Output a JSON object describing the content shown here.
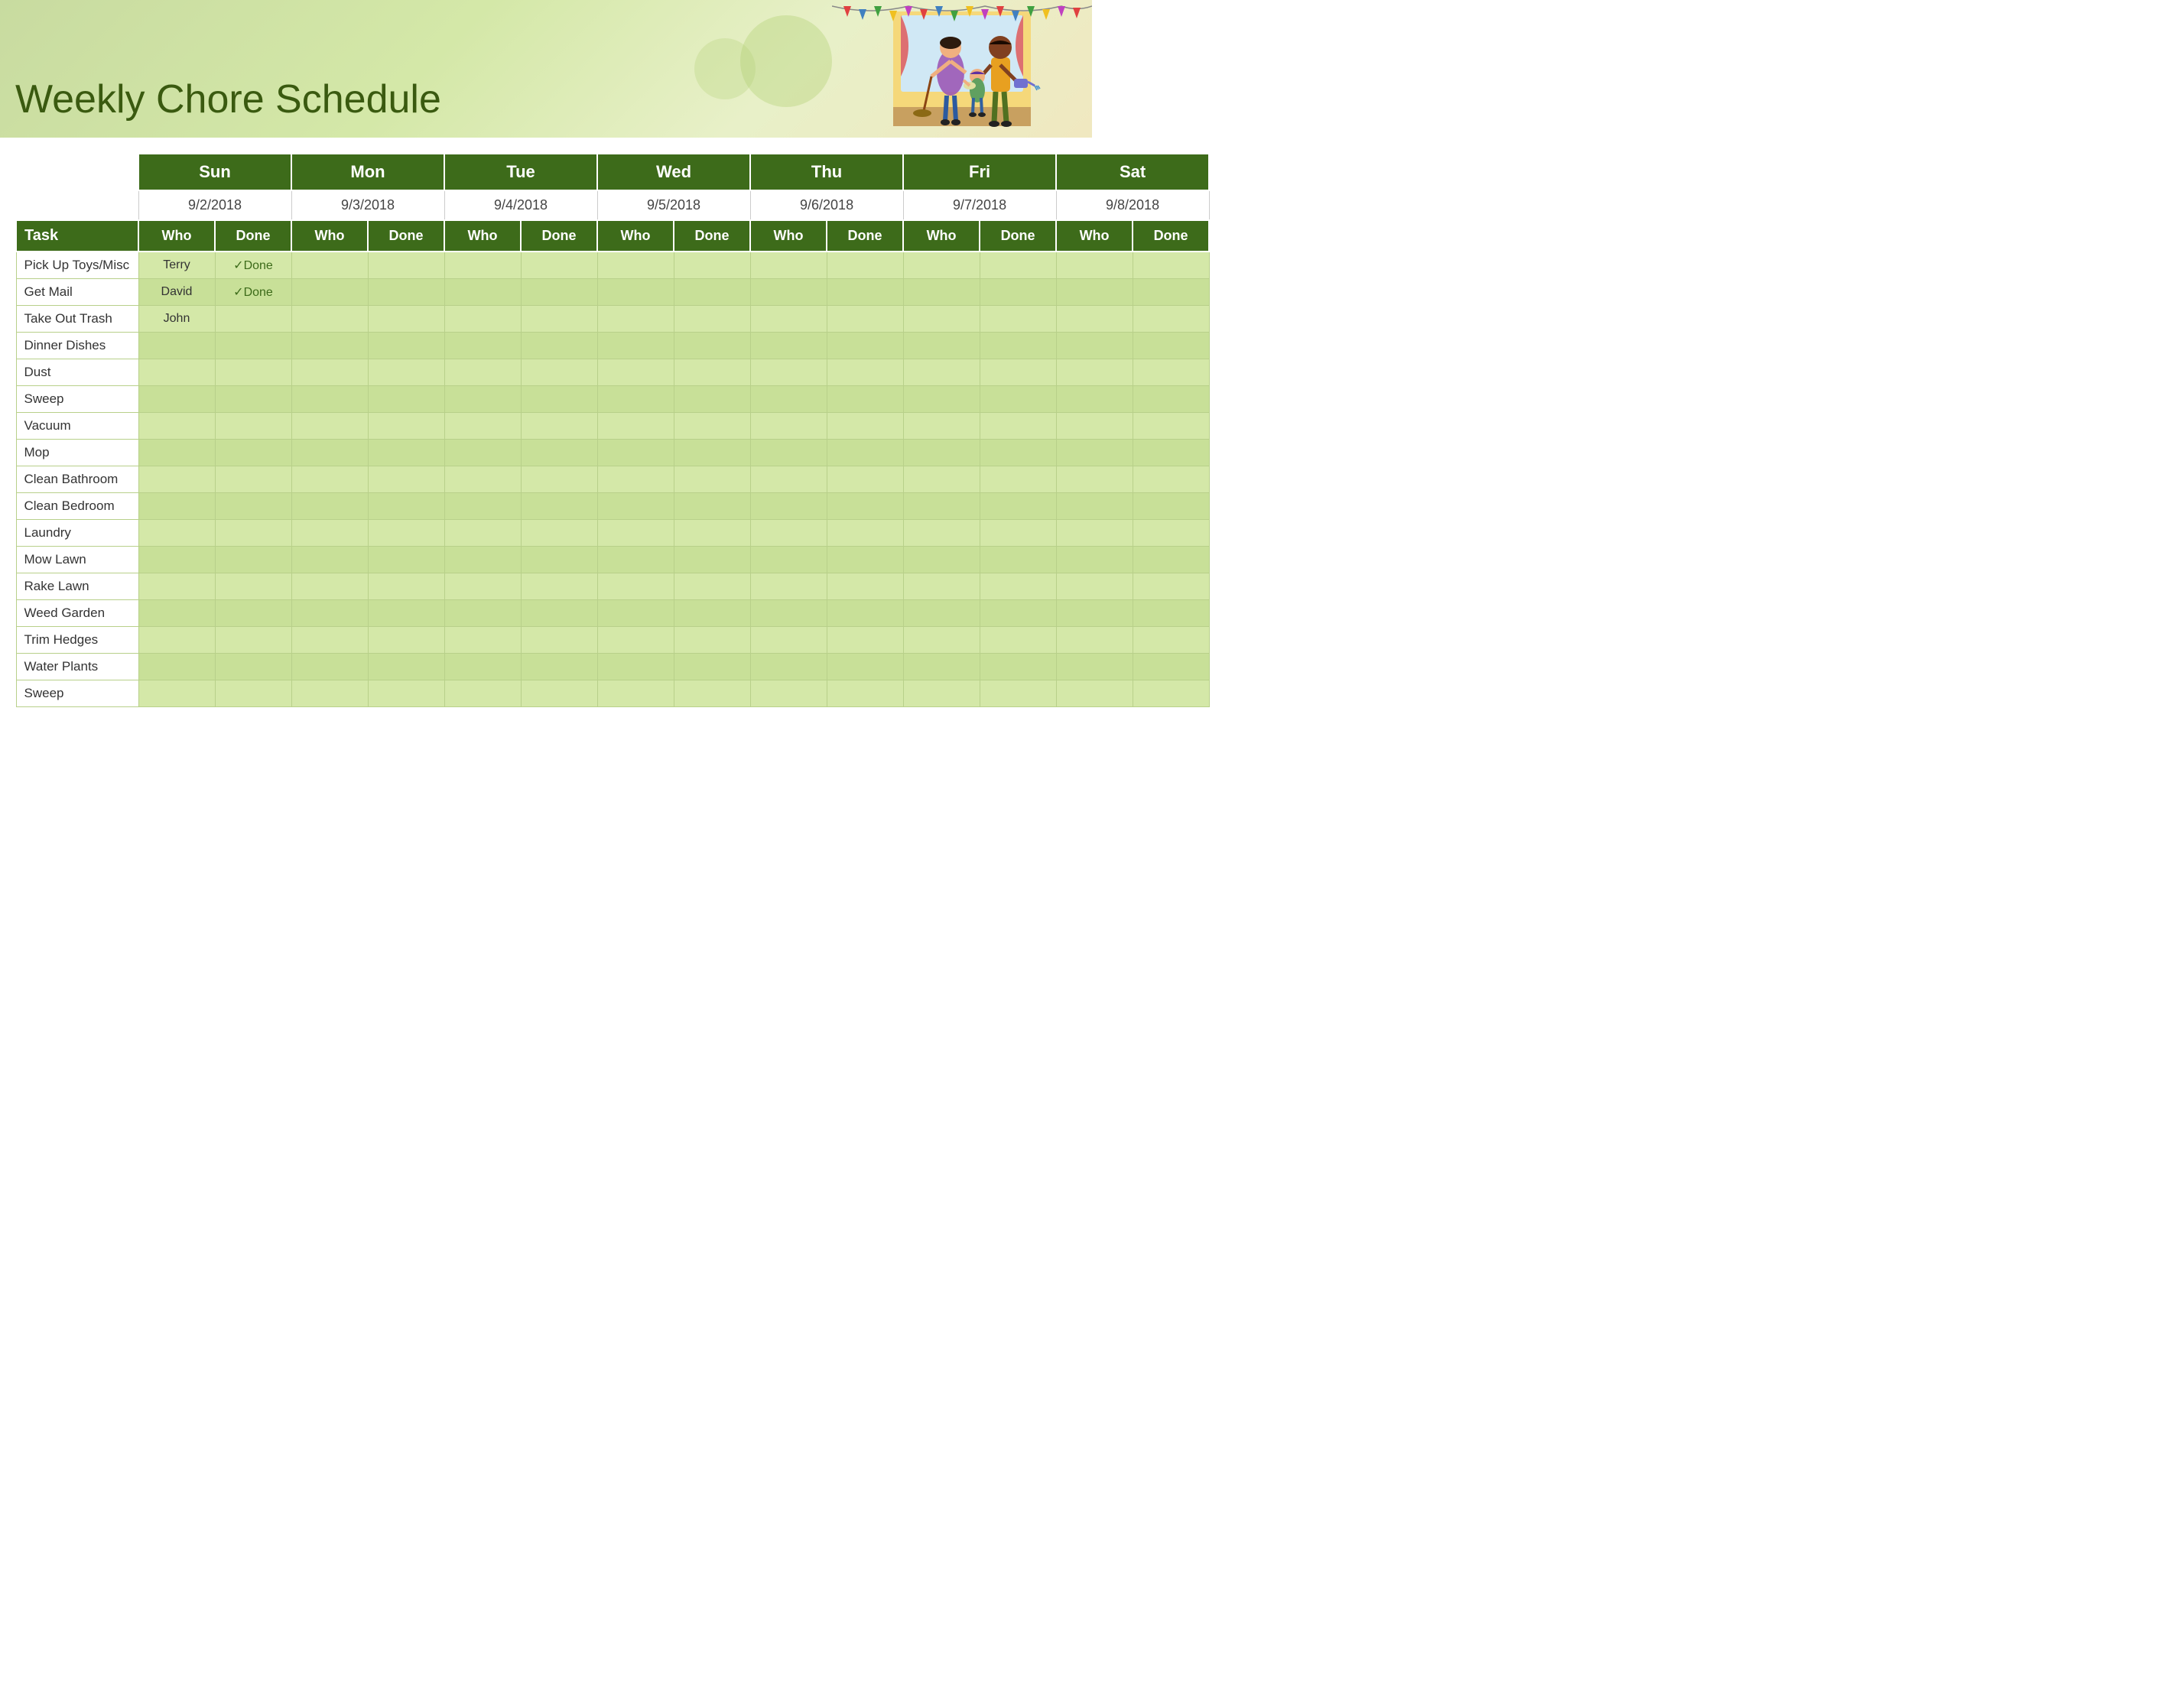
{
  "header": {
    "title": "Weekly Chore Schedule"
  },
  "table": {
    "days": [
      {
        "name": "Sun",
        "date": "9/2/2018"
      },
      {
        "name": "Mon",
        "date": "9/3/2018"
      },
      {
        "name": "Tue",
        "date": "9/4/2018"
      },
      {
        "name": "Wed",
        "date": "9/5/2018"
      },
      {
        "name": "Thu",
        "date": "9/6/2018"
      },
      {
        "name": "Fri",
        "date": "9/7/2018"
      },
      {
        "name": "Sat",
        "date": "9/8/2018"
      }
    ],
    "subheader": {
      "task": "Task",
      "who": "Who",
      "done": "Done"
    },
    "rows": [
      {
        "task": "Pick Up Toys/Misc",
        "sun_who": "Terry",
        "sun_done": "✓Done",
        "mon_who": "",
        "mon_done": "",
        "tue_who": "",
        "tue_done": "",
        "wed_who": "",
        "wed_done": "",
        "thu_who": "",
        "thu_done": "",
        "fri_who": "",
        "fri_done": "",
        "sat_who": "",
        "sat_done": ""
      },
      {
        "task": "Get Mail",
        "sun_who": "David",
        "sun_done": "✓Done",
        "mon_who": "",
        "mon_done": "",
        "tue_who": "",
        "tue_done": "",
        "wed_who": "",
        "wed_done": "",
        "thu_who": "",
        "thu_done": "",
        "fri_who": "",
        "fri_done": "",
        "sat_who": "",
        "sat_done": ""
      },
      {
        "task": "Take Out Trash",
        "sun_who": "John",
        "sun_done": "",
        "mon_who": "",
        "mon_done": "",
        "tue_who": "",
        "tue_done": "",
        "wed_who": "",
        "wed_done": "",
        "thu_who": "",
        "thu_done": "",
        "fri_who": "",
        "fri_done": "",
        "sat_who": "",
        "sat_done": ""
      },
      {
        "task": "Dinner Dishes",
        "sun_who": "",
        "sun_done": "",
        "mon_who": "",
        "mon_done": "",
        "tue_who": "",
        "tue_done": "",
        "wed_who": "",
        "wed_done": "",
        "thu_who": "",
        "thu_done": "",
        "fri_who": "",
        "fri_done": "",
        "sat_who": "",
        "sat_done": ""
      },
      {
        "task": "Dust",
        "sun_who": "",
        "sun_done": "",
        "mon_who": "",
        "mon_done": "",
        "tue_who": "",
        "tue_done": "",
        "wed_who": "",
        "wed_done": "",
        "thu_who": "",
        "thu_done": "",
        "fri_who": "",
        "fri_done": "",
        "sat_who": "",
        "sat_done": ""
      },
      {
        "task": "Sweep",
        "sun_who": "",
        "sun_done": "",
        "mon_who": "",
        "mon_done": "",
        "tue_who": "",
        "tue_done": "",
        "wed_who": "",
        "wed_done": "",
        "thu_who": "",
        "thu_done": "",
        "fri_who": "",
        "fri_done": "",
        "sat_who": "",
        "sat_done": ""
      },
      {
        "task": "Vacuum",
        "sun_who": "",
        "sun_done": "",
        "mon_who": "",
        "mon_done": "",
        "tue_who": "",
        "tue_done": "",
        "wed_who": "",
        "wed_done": "",
        "thu_who": "",
        "thu_done": "",
        "fri_who": "",
        "fri_done": "",
        "sat_who": "",
        "sat_done": ""
      },
      {
        "task": "Mop",
        "sun_who": "",
        "sun_done": "",
        "mon_who": "",
        "mon_done": "",
        "tue_who": "",
        "tue_done": "",
        "wed_who": "",
        "wed_done": "",
        "thu_who": "",
        "thu_done": "",
        "fri_who": "",
        "fri_done": "",
        "sat_who": "",
        "sat_done": ""
      },
      {
        "task": "Clean Bathroom",
        "sun_who": "",
        "sun_done": "",
        "mon_who": "",
        "mon_done": "",
        "tue_who": "",
        "tue_done": "",
        "wed_who": "",
        "wed_done": "",
        "thu_who": "",
        "thu_done": "",
        "fri_who": "",
        "fri_done": "",
        "sat_who": "",
        "sat_done": ""
      },
      {
        "task": "Clean Bedroom",
        "sun_who": "",
        "sun_done": "",
        "mon_who": "",
        "mon_done": "",
        "tue_who": "",
        "tue_done": "",
        "wed_who": "",
        "wed_done": "",
        "thu_who": "",
        "thu_done": "",
        "fri_who": "",
        "fri_done": "",
        "sat_who": "",
        "sat_done": ""
      },
      {
        "task": "Laundry",
        "sun_who": "",
        "sun_done": "",
        "mon_who": "",
        "mon_done": "",
        "tue_who": "",
        "tue_done": "",
        "wed_who": "",
        "wed_done": "",
        "thu_who": "",
        "thu_done": "",
        "fri_who": "",
        "fri_done": "",
        "sat_who": "",
        "sat_done": ""
      },
      {
        "task": "Mow Lawn",
        "sun_who": "",
        "sun_done": "",
        "mon_who": "",
        "mon_done": "",
        "tue_who": "",
        "tue_done": "",
        "wed_who": "",
        "wed_done": "",
        "thu_who": "",
        "thu_done": "",
        "fri_who": "",
        "fri_done": "",
        "sat_who": "",
        "sat_done": ""
      },
      {
        "task": "Rake Lawn",
        "sun_who": "",
        "sun_done": "",
        "mon_who": "",
        "mon_done": "",
        "tue_who": "",
        "tue_done": "",
        "wed_who": "",
        "wed_done": "",
        "thu_who": "",
        "thu_done": "",
        "fri_who": "",
        "fri_done": "",
        "sat_who": "",
        "sat_done": ""
      },
      {
        "task": "Weed Garden",
        "sun_who": "",
        "sun_done": "",
        "mon_who": "",
        "mon_done": "",
        "tue_who": "",
        "tue_done": "",
        "wed_who": "",
        "wed_done": "",
        "thu_who": "",
        "thu_done": "",
        "fri_who": "",
        "fri_done": "",
        "sat_who": "",
        "sat_done": ""
      },
      {
        "task": "Trim Hedges",
        "sun_who": "",
        "sun_done": "",
        "mon_who": "",
        "mon_done": "",
        "tue_who": "",
        "tue_done": "",
        "wed_who": "",
        "wed_done": "",
        "thu_who": "",
        "thu_done": "",
        "fri_who": "",
        "fri_done": "",
        "sat_who": "",
        "sat_done": ""
      },
      {
        "task": "Water Plants",
        "sun_who": "",
        "sun_done": "",
        "mon_who": "",
        "mon_done": "",
        "tue_who": "",
        "tue_done": "",
        "wed_who": "",
        "wed_done": "",
        "thu_who": "",
        "thu_done": "",
        "fri_who": "",
        "fri_done": "",
        "sat_who": "",
        "sat_done": ""
      },
      {
        "task": "Sweep",
        "sun_who": "",
        "sun_done": "",
        "mon_who": "",
        "mon_done": "",
        "tue_who": "",
        "tue_done": "",
        "wed_who": "",
        "wed_done": "",
        "thu_who": "",
        "thu_done": "",
        "fri_who": "",
        "fri_done": "",
        "sat_who": "",
        "sat_done": ""
      }
    ]
  }
}
